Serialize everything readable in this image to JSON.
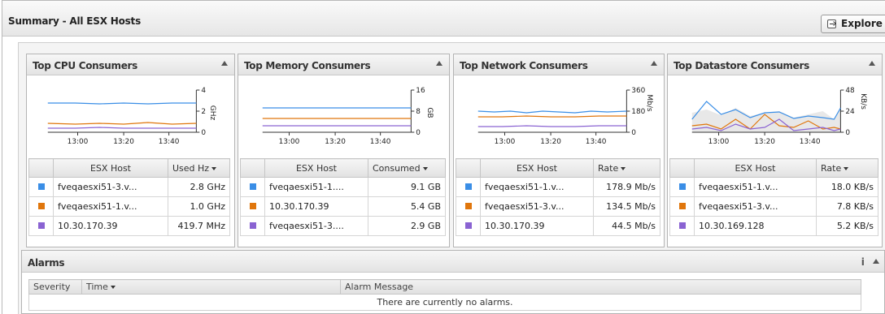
{
  "page": {
    "title": "Summary - All ESX Hosts",
    "explore_label": "Explore"
  },
  "colors": {
    "blue": "#3a8ee6",
    "orange": "#e0760c",
    "purple": "#8a63d2"
  },
  "panels": [
    {
      "title": "Top CPU Consumers",
      "axis": {
        "ticks": [
          "4",
          "2",
          "0"
        ],
        "unit": "GHz",
        "x_ticks": [
          "13:00",
          "13:20",
          "13:40"
        ]
      },
      "columns": [
        "ESX Host",
        "Used Hz"
      ],
      "rows": [
        {
          "host": "fveqaesxi51-3.v...",
          "value": "2.8 GHz"
        },
        {
          "host": "fveqaesxi51-1.v...",
          "value": "1.0 GHz"
        },
        {
          "host": "10.30.170.39",
          "value": "419.7 MHz"
        }
      ]
    },
    {
      "title": "Top Memory Consumers",
      "axis": {
        "ticks": [
          "16",
          "8",
          "0"
        ],
        "unit": "GB",
        "x_ticks": [
          "13:00",
          "13:20",
          "13:40"
        ]
      },
      "columns": [
        "ESX Host",
        "Consumed"
      ],
      "rows": [
        {
          "host": "fveqaesxi51-1....",
          "value": "9.1 GB"
        },
        {
          "host": "10.30.170.39",
          "value": "5.4 GB"
        },
        {
          "host": "fveqaesxi51-3....",
          "value": "2.9 GB"
        }
      ]
    },
    {
      "title": "Top Network Consumers",
      "axis": {
        "ticks": [
          "360",
          "180",
          "0"
        ],
        "unit": "Mb/s",
        "x_ticks": [
          "13:00",
          "13:20",
          "13:40"
        ]
      },
      "columns": [
        "ESX Host",
        "Rate"
      ],
      "rows": [
        {
          "host": "fveqaesxi51-1.v...",
          "value": "178.9 Mb/s"
        },
        {
          "host": "fveqaesxi51-3.v...",
          "value": "134.5 Mb/s"
        },
        {
          "host": "10.30.170.39",
          "value": "44.5 Mb/s"
        }
      ]
    },
    {
      "title": "Top Datastore Consumers",
      "axis": {
        "ticks": [
          "48",
          "24",
          "0"
        ],
        "unit": "KB/s",
        "x_ticks": [
          "13:00",
          "13:20",
          "13:40"
        ]
      },
      "columns": [
        "ESX Host",
        "Rate"
      ],
      "rows": [
        {
          "host": "fveqaesxi51-1.v...",
          "value": "18.0 KB/s"
        },
        {
          "host": "fveqaesxi51-3.v...",
          "value": "7.8 KB/s"
        },
        {
          "host": "10.30.169.128",
          "value": "5.2 KB/s"
        }
      ]
    }
  ],
  "alarms": {
    "title": "Alarms",
    "info_icon": "i",
    "columns": {
      "severity": "Severity",
      "time": "Time",
      "message": "Alarm Message"
    },
    "empty_text": "There are currently no alarms."
  }
}
